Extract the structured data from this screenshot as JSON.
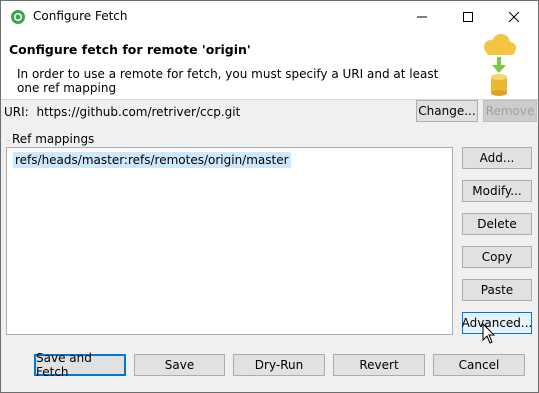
{
  "window": {
    "title": "Configure Fetch",
    "controls": [
      "minimize-icon",
      "maximize-icon",
      "close-icon"
    ]
  },
  "header": {
    "title": "Configure fetch for remote 'origin'",
    "description": "In order to use a remote for fetch, you must specify a URI and at least one ref mapping",
    "graphic": "cloud-download-database-icon"
  },
  "uri": {
    "label": "URI:",
    "value": "https://github.com/retriver/ccp.git",
    "change_label": "Change...",
    "remove_label": "Remove"
  },
  "ref_mappings": {
    "group_label": "Ref mappings",
    "items": [
      "refs/heads/master:refs/remotes/origin/master"
    ],
    "selected_index": 0
  },
  "side_buttons": {
    "add": "Add...",
    "modify": "Modify...",
    "delete": "Delete",
    "copy": "Copy",
    "paste": "Paste",
    "advanced": "Advanced..."
  },
  "footer_buttons": {
    "save_fetch": "Save and Fetch",
    "save": "Save",
    "dry_run": "Dry-Run",
    "revert": "Revert",
    "cancel": "Cancel"
  },
  "colors": {
    "selection": "#cce8ff",
    "default_button_border": "#0078d7",
    "cloud": "#f5c542",
    "arrow": "#7ac943",
    "database": "#e8b830"
  }
}
